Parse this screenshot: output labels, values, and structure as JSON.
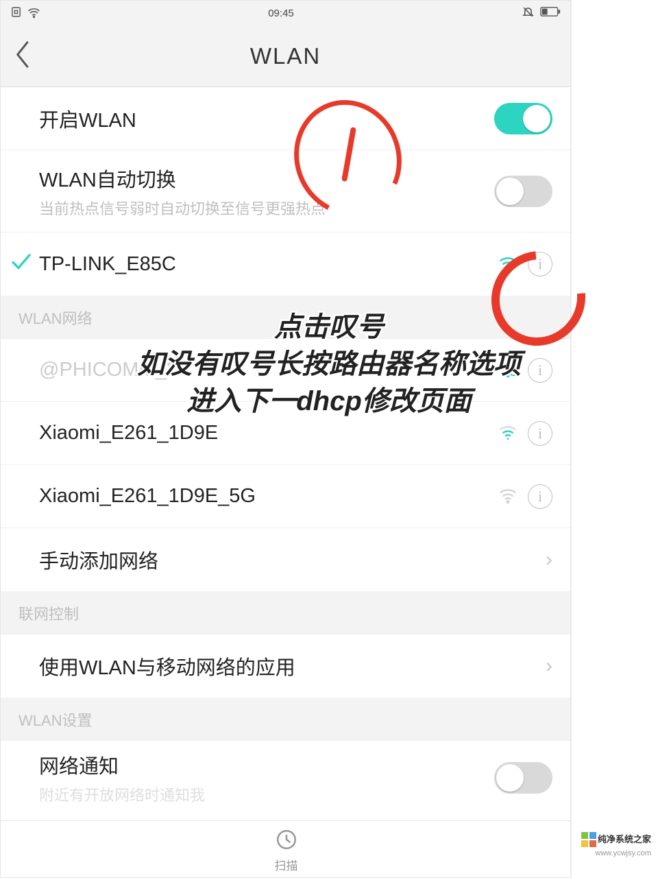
{
  "status": {
    "time": "09:45"
  },
  "navbar": {
    "title": "WLAN"
  },
  "rows": {
    "enable_wlan": {
      "label": "开启WLAN",
      "toggle_on": true
    },
    "auto_switch": {
      "label": "WLAN自动切换",
      "sub": "当前热点信号弱时自动切换至信号更强热点",
      "toggle_on": false
    },
    "connected": {
      "ssid": "TP-LINK_E85C"
    }
  },
  "sections": {
    "networks_header": "WLAN网络",
    "control_header": "联网控制",
    "settings_header": "WLAN设置"
  },
  "networks": [
    {
      "ssid": "@PHICOMM_2A",
      "strong": true,
      "locked": true
    },
    {
      "ssid": "Xiaomi_E261_1D9E",
      "strong": true,
      "locked": false
    },
    {
      "ssid": "Xiaomi_E261_1D9E_5G",
      "strong": false,
      "locked": false
    }
  ],
  "manual_add": "手动添加网络",
  "app_control": "使用WLAN与移动网络的应用",
  "notification": {
    "label": "网络通知",
    "sub": "附近有开放网络时通知我"
  },
  "bottombar": {
    "scan": "扫描"
  },
  "annotations": {
    "line1": "点击叹号",
    "line2": "如没有叹号长按路由器名称选项",
    "line3": "进入下一dhcp修改页面"
  },
  "watermark": {
    "name": "纯净系统之家",
    "url": "www.ycwjsy.com"
  }
}
